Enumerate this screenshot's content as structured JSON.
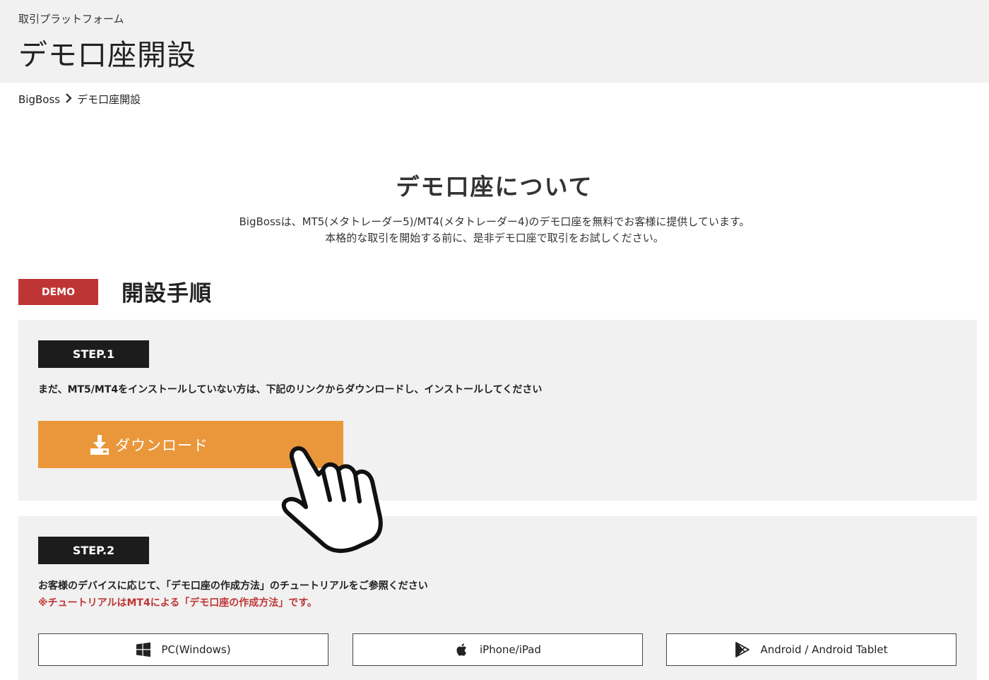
{
  "header": {
    "subtitle": "取引プラットフォーム",
    "title": "デモ口座開設"
  },
  "breadcrumb": {
    "home": "BigBoss",
    "current": "デモ口座開設"
  },
  "about": {
    "title": "デモ口座について",
    "line1": "BigBossは、MT5(メタトレーダー5)/MT4(メタトレーダー4)のデモ口座を無料でお客様に提供しています。",
    "line2": "本格的な取引を開始する前に、是非デモ口座で取引をお試しください。"
  },
  "procedure": {
    "badge": "DEMO",
    "title": "開設手順"
  },
  "step1": {
    "label": "STEP.1",
    "description": "まだ、MT5/MT4をインストールしていない方は、下記のリンクからダウンロードし、インストールしてください",
    "download_label": "ダウンロード"
  },
  "step2": {
    "label": "STEP.2",
    "description": "お客様のデバイスに応じて、「デモ口座の作成方法」のチュートリアルをご参照ください",
    "note": "※チュートリアルはMT4による「デモ口座の作成方法」です。",
    "devices": [
      {
        "label": "PC(Windows)",
        "icon": "windows-icon"
      },
      {
        "label": "iPhone/iPad",
        "icon": "apple-icon"
      },
      {
        "label": "Android / Android Tablet",
        "icon": "google-play-icon"
      }
    ]
  },
  "colors": {
    "header_bg": "#f1f1f1",
    "badge_red": "#bf3535",
    "step_label_bg": "#1c1c1c",
    "download_orange": "#ea973b",
    "note_red": "#bf3535"
  }
}
